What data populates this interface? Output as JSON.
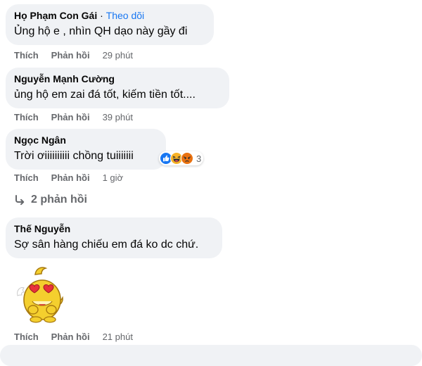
{
  "labels": {
    "like": "Thích",
    "reply": "Phản hồi"
  },
  "comments": [
    {
      "author": "Họ Phạm Con Gái",
      "follow_separator": "·",
      "follow_label": "Theo dõi",
      "text": "Ủng hộ e , nhìn QH dạo này gầy đi",
      "time": "29 phút"
    },
    {
      "author": "Nguyễn Mạnh Cường",
      "text": "ủng hộ em zai đá tốt, kiếm tiền tốt....",
      "time": "39 phút"
    },
    {
      "author": "Ngọc Ngân",
      "text": "Trời ơiiiiiiiiii chồng tuiiiiiii",
      "time": "1 giờ",
      "reactions": {
        "icons": [
          "like-icon",
          "haha-icon",
          "angry-icon"
        ],
        "count": "3"
      }
    },
    {
      "author": "Thế Nguyễn",
      "text": "Sợ sân hàng chiếu em đá ko dc chứ.",
      "time": "21 phút",
      "sticker": "love-eyes-sticker"
    }
  ],
  "more_replies": {
    "label": "2 phản hồi"
  },
  "colors": {
    "bubble": "#f0f2f5",
    "meta": "#65676b",
    "link": "#1877f2",
    "like_blue": "#1877f2",
    "angry_orange": "#e9710f",
    "haha_yellow": "#f7b125"
  }
}
